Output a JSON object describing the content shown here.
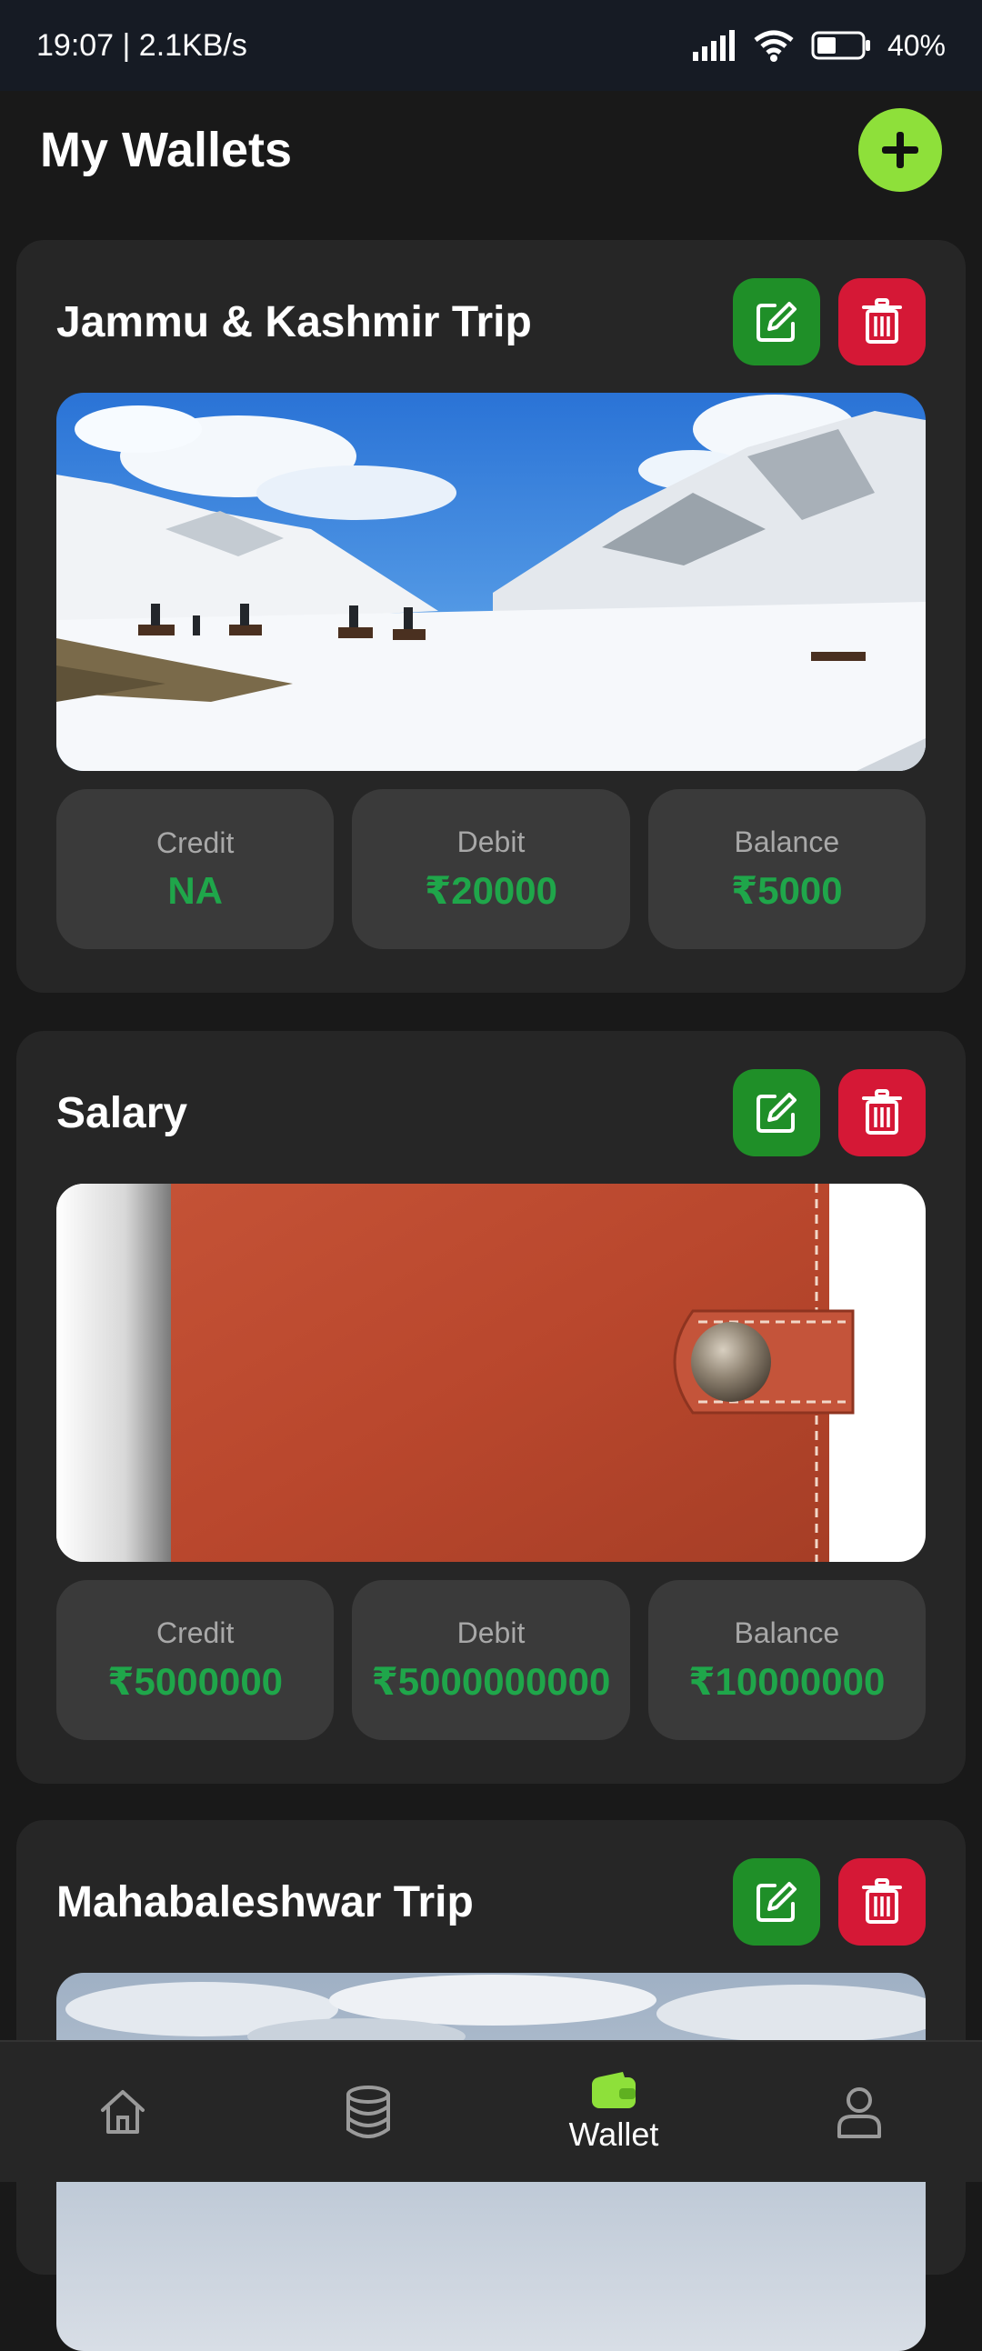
{
  "status_bar": {
    "time_speed": "19:07 | 2.1KB/s",
    "battery": "40%"
  },
  "header": {
    "title": "My Wallets"
  },
  "wallets": [
    {
      "name": "Jammu & Kashmir Trip",
      "image": "snowy-mountains-photo",
      "stats": [
        {
          "label": "Credit",
          "value": "NA"
        },
        {
          "label": "Debit",
          "value": "₹20000"
        },
        {
          "label": "Balance",
          "value": "₹5000"
        }
      ]
    },
    {
      "name": "Salary",
      "image": "leather-wallet-photo",
      "stats": [
        {
          "label": "Credit",
          "value": "₹5000000"
        },
        {
          "label": "Debit",
          "value": "₹5000000000"
        },
        {
          "label": "Balance",
          "value": "₹10000000"
        }
      ]
    },
    {
      "name": "Mahabaleshwar Trip",
      "image": "cloudy-sky-photo"
    }
  ],
  "bottom_nav": {
    "items": [
      {
        "icon": "home-icon",
        "label": ""
      },
      {
        "icon": "database-icon",
        "label": ""
      },
      {
        "icon": "wallet-icon",
        "label": "Wallet",
        "active": true
      },
      {
        "icon": "user-icon",
        "label": ""
      }
    ]
  },
  "colors": {
    "accent": "#8ee03a",
    "edit": "#1f8f28",
    "delete": "#d51836",
    "positive": "#1fa64a",
    "background": "#191919",
    "card": "#262626"
  }
}
